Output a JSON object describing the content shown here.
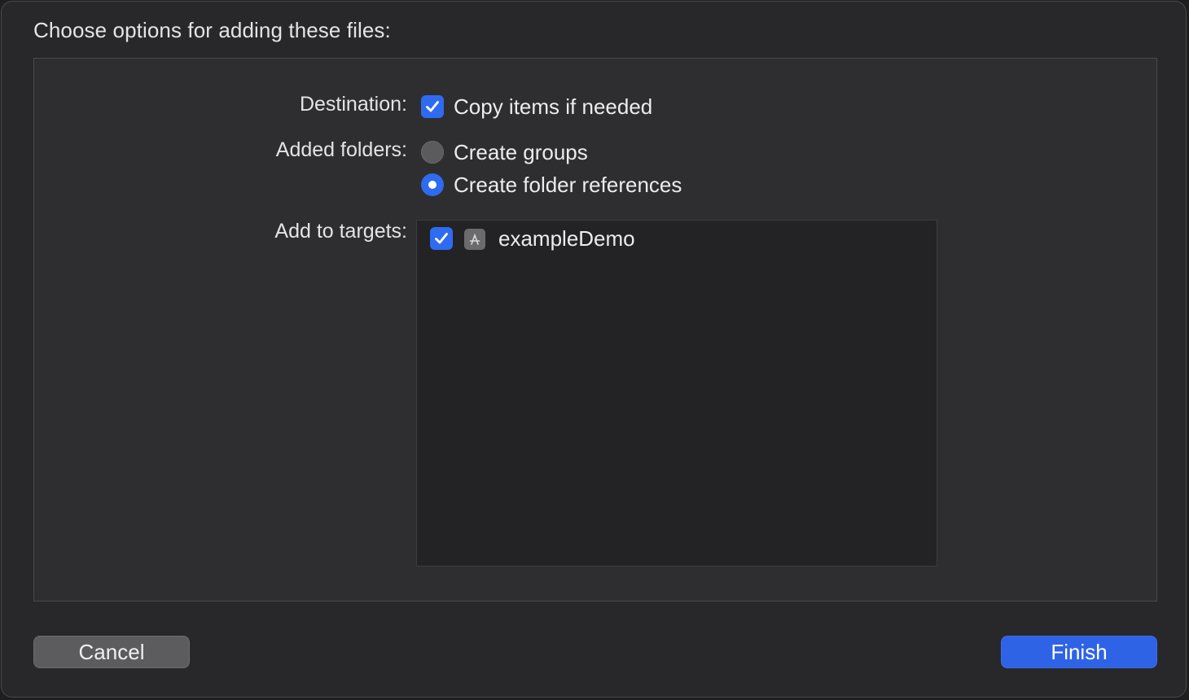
{
  "sheet": {
    "title": "Choose options for adding these files:"
  },
  "destination": {
    "label": "Destination:",
    "checkbox_label": "Copy items if needed",
    "checked": true
  },
  "added_folders": {
    "label": "Added folders:",
    "options": [
      {
        "label": "Create groups",
        "selected": false
      },
      {
        "label": "Create folder references",
        "selected": true
      }
    ]
  },
  "targets": {
    "label": "Add to targets:",
    "items": [
      {
        "name": "exampleDemo",
        "checked": true,
        "icon": "app-target-icon"
      }
    ]
  },
  "buttons": {
    "cancel": "Cancel",
    "finish": "Finish"
  },
  "colors": {
    "accent": "#2f6bf0",
    "panel_bg": "#2e2e30",
    "window_bg": "#28282a"
  }
}
